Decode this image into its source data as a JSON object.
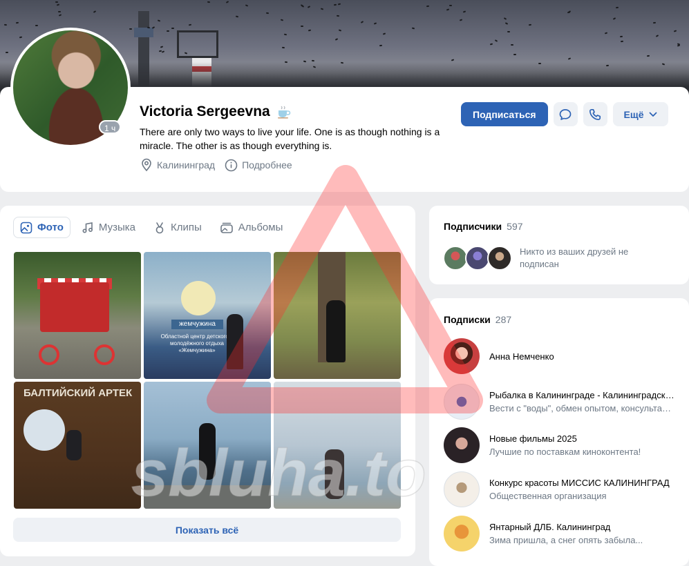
{
  "profile": {
    "name": "Victoria Sergeevna",
    "status": "There are only two ways to live your life. One is as though nothing is a miracle. The other is as though everything is.",
    "last_seen_badge": "1 ч",
    "city": "Калининград",
    "details_label": "Подробнее",
    "name_emoji_icon": "coffee-cup-icon"
  },
  "actions": {
    "subscribe_label": "Подписаться",
    "message_icon": "message-icon",
    "call_icon": "phone-icon",
    "more_label": "Ещё"
  },
  "media": {
    "tabs": [
      {
        "label": "Фото",
        "icon": "photo-icon",
        "active": true
      },
      {
        "label": "Музыка",
        "icon": "music-icon",
        "active": false
      },
      {
        "label": "Клипы",
        "icon": "clips-icon",
        "active": false
      },
      {
        "label": "Альбомы",
        "icon": "albums-icon",
        "active": false
      }
    ],
    "photos": [
      {
        "sign": "",
        "sub": ""
      },
      {
        "sign": "жемчужина",
        "sub": "Областной центр детского и молодёжного отдыха «Жемчужина»"
      },
      {
        "sign": "",
        "sub": ""
      },
      {
        "sign": "БАЛТИЙСКИЙ АРТЕК",
        "sub": ""
      },
      {
        "sign": "",
        "sub": ""
      },
      {
        "sign": "",
        "sub": ""
      }
    ],
    "show_all_label": "Показать всё"
  },
  "followers": {
    "title": "Подписчики",
    "count": "597",
    "note": "Никто из ваших друзей не подписан"
  },
  "subscriptions": {
    "title": "Подписки",
    "count": "287",
    "items": [
      {
        "name": "Анна Немченко",
        "desc": ""
      },
      {
        "name": "Рыбалка в Калининграде - Калининградская область",
        "desc": "Вести с \"воды\", обмен опытом, консультации"
      },
      {
        "name": "Новые фильмы 2025",
        "desc": "Лучшие по поставкам киноконтента!"
      },
      {
        "name": "Конкурс красоты МИССИС КАЛИНИНГРАД",
        "desc": "Общественная организация"
      },
      {
        "name": "Янтарный ДЛБ. Калининград",
        "desc": "Зима пришла, а снег опять забыла..."
      }
    ]
  },
  "watermark": {
    "text": "sbluha.to",
    "color": "#ff2d2d"
  },
  "colors": {
    "accent": "#2d63b5",
    "secondary_text": "#6d7885",
    "page_bg": "#edeef0"
  }
}
